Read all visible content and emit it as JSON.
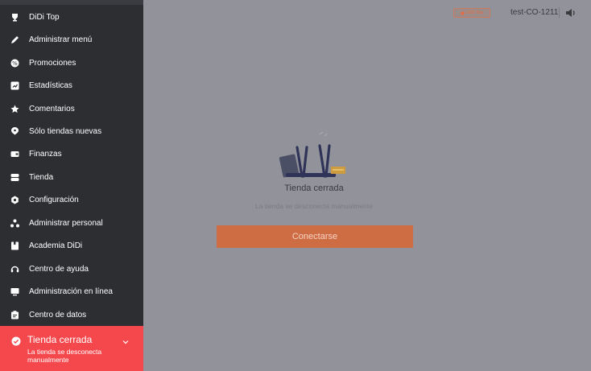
{
  "sidebar": {
    "items": [
      {
        "label": "DiDi Top",
        "icon": "trophy-icon"
      },
      {
        "label": "Administrar menú",
        "icon": "pencil-icon"
      },
      {
        "label": "Promociones",
        "icon": "promotion-icon"
      },
      {
        "label": "Estadísticas",
        "icon": "statistics-icon"
      },
      {
        "label": "Comentarios",
        "icon": "star-icon"
      },
      {
        "label": "Sólo tiendas nuevas",
        "icon": "new-store-icon"
      },
      {
        "label": "Finanzas",
        "icon": "wallet-icon"
      },
      {
        "label": "Tienda",
        "icon": "store-icon"
      },
      {
        "label": "Configuración",
        "icon": "gear-icon"
      },
      {
        "label": "Administrar personal",
        "icon": "staff-icon"
      },
      {
        "label": "Academia DiDi",
        "icon": "book-icon"
      },
      {
        "label": "Centro de ayuda",
        "icon": "headset-icon"
      },
      {
        "label": "Administración en línea",
        "icon": "monitor-icon"
      },
      {
        "label": "Centro de datos",
        "icon": "clipboard-icon"
      }
    ],
    "status": {
      "title": "Tienda cerrada",
      "subtitle": "La tienda se desconecta manualmente"
    }
  },
  "topbar": {
    "badge": "DiDi Top",
    "user": "test-CO-1211"
  },
  "main": {
    "closed_title": "Tienda cerrada",
    "closed_subtitle": "La tienda se desconecta manualmente",
    "connect_label": "Conectarse"
  },
  "colors": {
    "sidebar_bg": "#2c2e32",
    "status_red": "#f5484d",
    "overlay_bg": "#92939a",
    "button_orange": "#ce6d44"
  }
}
